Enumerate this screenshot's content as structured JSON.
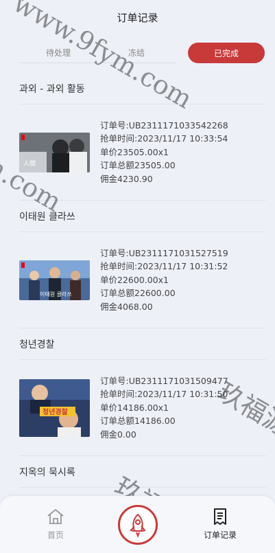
{
  "header": {
    "title": "订单记录"
  },
  "tabs": [
    {
      "label": "待处理",
      "active": false
    },
    {
      "label": "冻结",
      "active": false
    },
    {
      "label": "已完成",
      "active": true
    }
  ],
  "orders": [
    {
      "title": "과외 - 과외 활동",
      "poster_icon": "poster-extracurricular",
      "order_no": "订单号:UB2311171033542268",
      "time": "抢单时间:2023/11/17 10:33:54",
      "unit_price": "单价23505.00x1",
      "total": "订单总额23505.00",
      "commission": "佣金4230.90"
    },
    {
      "title": "이태원 클라쓰",
      "poster_icon": "poster-itaewon-class",
      "order_no": "订单号:UB2311171031527519",
      "time": "抢单时间:2023/11/17 10:31:52",
      "unit_price": "单价22600.00x1",
      "total": "订单总额22600.00",
      "commission": "佣金4068.00"
    },
    {
      "title": "청년경찰",
      "poster_icon": "poster-midnight-runners",
      "order_no": "订单号:UB2311171031509477",
      "time": "抢单时间:2023/11/17 10:31:50",
      "unit_price": "单价14186.00x1",
      "total": "订单总额14186.00",
      "commission": "佣金0.00"
    }
  ],
  "partial_order": {
    "title": "지옥의 묵시록"
  },
  "tabbar": {
    "home_label": "首页",
    "orders_label": "订单记录",
    "center_icon": "rocket-icon"
  },
  "colors": {
    "accent": "#c8393a",
    "background": "#eef0f8"
  },
  "watermarks": [
    "www.9fym.com",
    "m.com",
    "玖福源码",
    "玖福源码"
  ]
}
